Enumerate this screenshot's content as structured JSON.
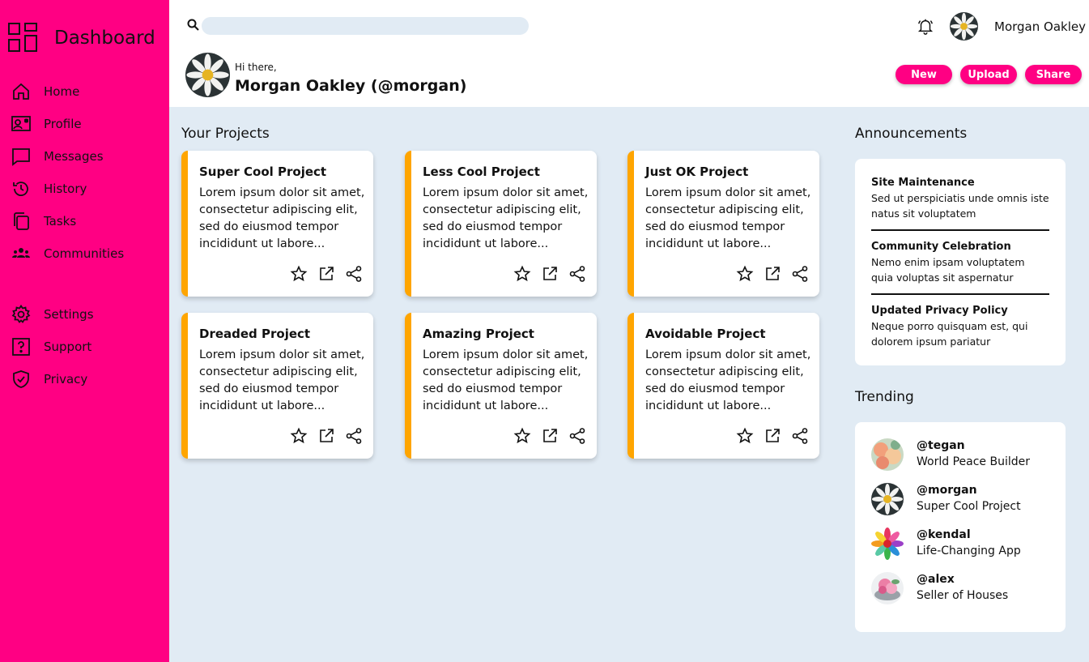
{
  "sidebar": {
    "title": "Dashboard",
    "items": [
      {
        "label": "Home",
        "icon": "home-icon"
      },
      {
        "label": "Profile",
        "icon": "profile-icon"
      },
      {
        "label": "Messages",
        "icon": "messages-icon"
      },
      {
        "label": "History",
        "icon": "history-icon"
      },
      {
        "label": "Tasks",
        "icon": "tasks-icon"
      },
      {
        "label": "Communities",
        "icon": "communities-icon"
      },
      {
        "label": "Settings",
        "icon": "gear-icon"
      },
      {
        "label": "Support",
        "icon": "help-icon"
      },
      {
        "label": "Privacy",
        "icon": "shield-icon"
      }
    ]
  },
  "header": {
    "search_placeholder": "",
    "user_name": "Morgan Oakley",
    "greeting": "Hi there,",
    "full_name": "Morgan Oakley (@morgan)",
    "buttons": {
      "new": "New",
      "upload": "Upload",
      "share": "Share"
    }
  },
  "projects": {
    "title": "Your Projects",
    "items": [
      {
        "title": "Super Cool Project",
        "body": "Lorem ipsum dolor sit amet, consectetur adipiscing elit, sed do eiusmod tempor incididunt ut labore..."
      },
      {
        "title": "Less Cool Project",
        "body": "Lorem ipsum dolor sit amet, consectetur adipiscing elit, sed do eiusmod tempor incididunt ut labore..."
      },
      {
        "title": "Just OK Project",
        "body": "Lorem ipsum dolor sit amet, consectetur adipiscing elit, sed do eiusmod tempor incididunt ut labore..."
      },
      {
        "title": "Dreaded Project",
        "body": "Lorem ipsum dolor sit amet, consectetur adipiscing elit, sed do eiusmod tempor incididunt ut labore..."
      },
      {
        "title": "Amazing Project",
        "body": "Lorem ipsum dolor sit amet, consectetur adipiscing elit, sed do eiusmod tempor incididunt ut labore..."
      },
      {
        "title": "Avoidable Project",
        "body": "Lorem ipsum dolor sit amet, consectetur adipiscing elit, sed do eiusmod tempor incididunt ut labore..."
      }
    ]
  },
  "announcements": {
    "title": "Announcements",
    "items": [
      {
        "title": "Site Maintenance",
        "body": "Sed ut perspiciatis unde omnis iste natus sit voluptatem"
      },
      {
        "title": "Community Celebration",
        "body": "Nemo enim ipsam voluptatem quia voluptas sit aspernatur"
      },
      {
        "title": "Updated Privacy Policy",
        "body": "Neque porro quisquam est, qui dolorem ipsum pariatur"
      }
    ]
  },
  "trending": {
    "title": "Trending",
    "items": [
      {
        "handle": "@tegan",
        "sub": "World Peace Builder"
      },
      {
        "handle": "@morgan",
        "sub": "Super Cool Project"
      },
      {
        "handle": "@kendal",
        "sub": "Life-Changing App"
      },
      {
        "handle": "@alex",
        "sub": "Seller of Houses"
      }
    ]
  },
  "colors": {
    "accent": "#ff0083",
    "card_stripe": "#ffa500",
    "background": "#e1ebf4"
  }
}
